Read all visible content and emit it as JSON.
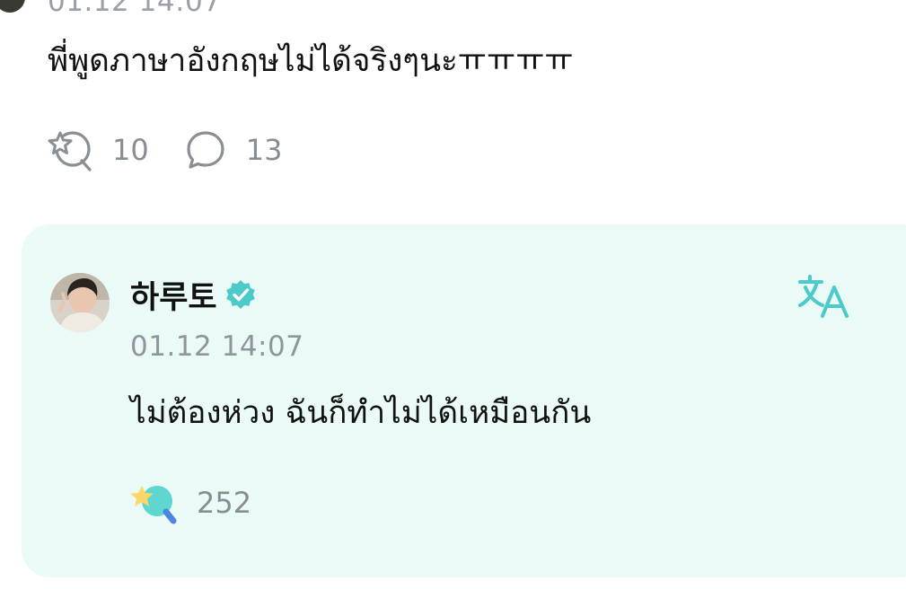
{
  "previous_post": {
    "timestamp": "01.12 14:07",
    "text": "พี่พูดภาษาอังกฤษไม่ได้จริงๆนะㅠㅠㅠㅠ",
    "reaction_count": "10",
    "comment_count": "13",
    "icons": {
      "reaction": "star-bubble-icon",
      "comment": "comment-bubble-icon"
    }
  },
  "reply": {
    "author": "하루토",
    "verified_icon": "verified-badge-icon",
    "translate_icon": "translate-icon",
    "timestamp": "01.12 14:07",
    "text": "ไม่ต้องห่วง ฉันก็ทำไม่ได้เหมือนกัน",
    "reaction_count": "252",
    "reaction_icon": "star-bubble-filled-icon"
  },
  "colors": {
    "card_background": "#e9faf7",
    "accent_teal": "#4cc9c9",
    "muted_text": "#888d92",
    "primary_text": "#111111"
  }
}
